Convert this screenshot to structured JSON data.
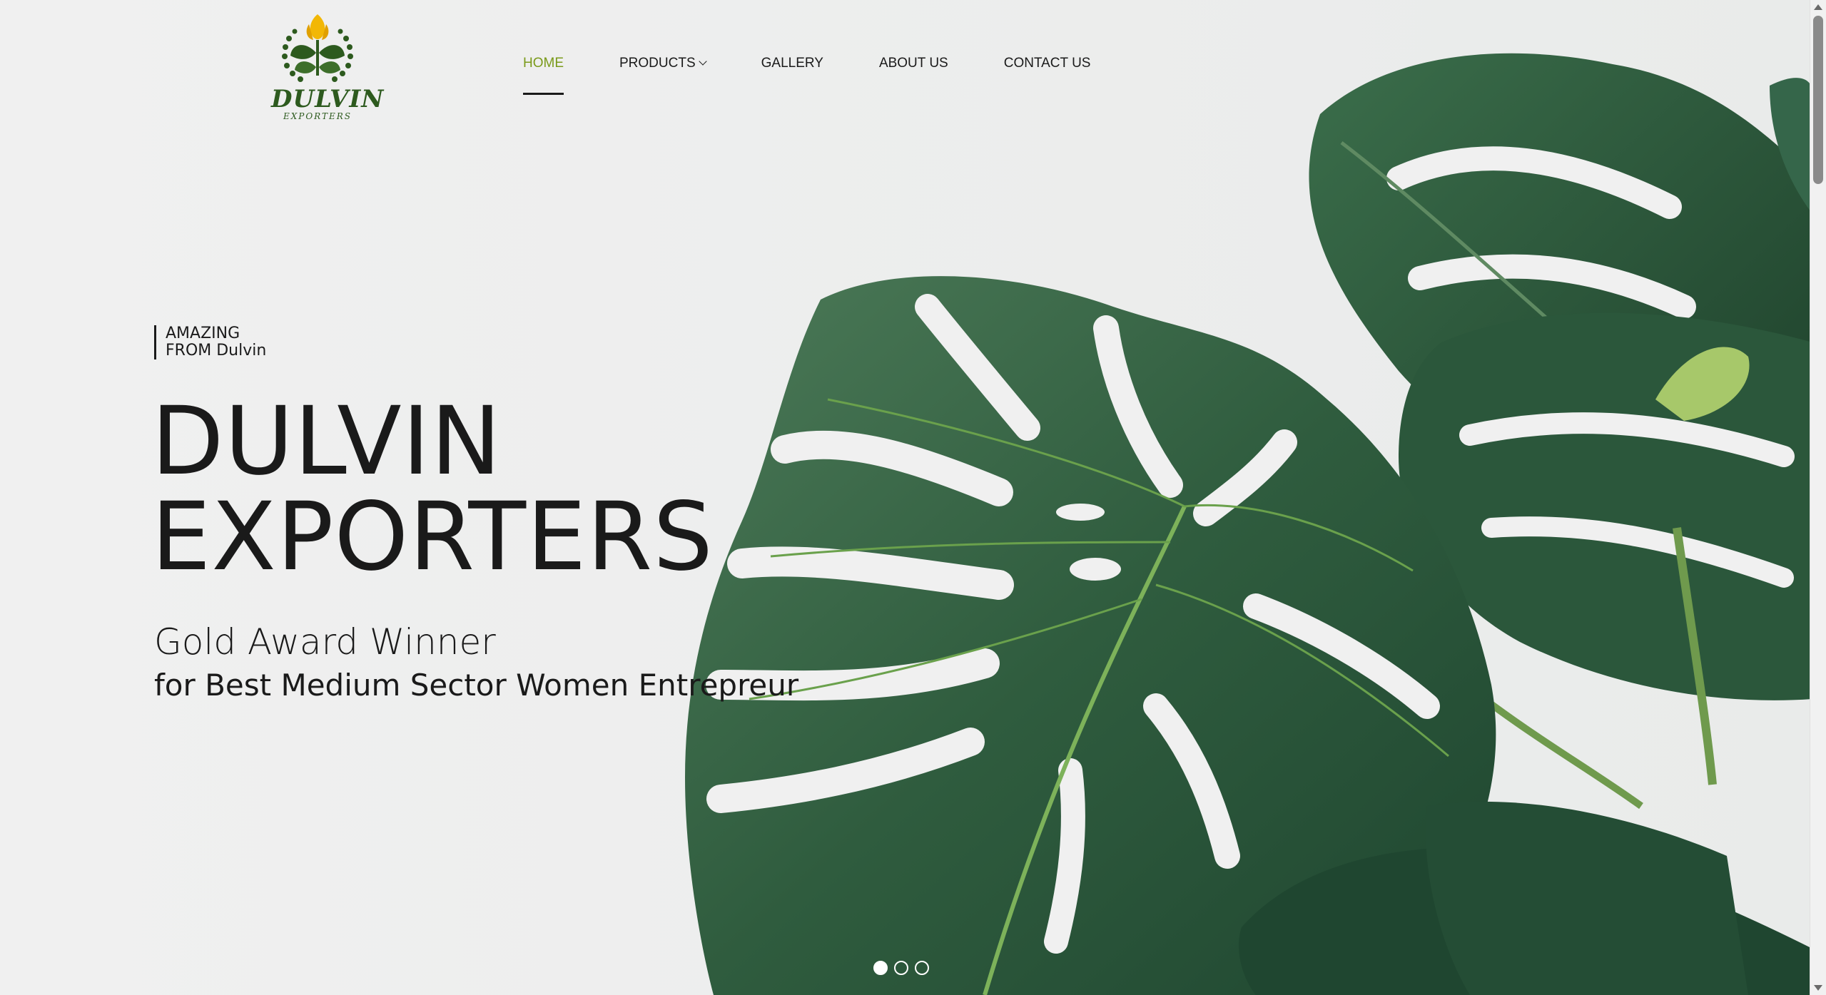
{
  "brand": {
    "name": "DULVIN",
    "sub": "EXPORTERS",
    "accent": "#7a9a1a",
    "leaf_dark": "#2d5a1e",
    "flower": "#f2b705"
  },
  "nav": {
    "items": [
      {
        "label": "HOME",
        "active": true
      },
      {
        "label": "PRODUCTS",
        "has_dropdown": true
      },
      {
        "label": "GALLERY"
      },
      {
        "label": "ABOUT US"
      },
      {
        "label": "CONTACT US"
      }
    ]
  },
  "hero": {
    "tagline_line1": "AMAZING",
    "tagline_line2": "FROM Dulvin",
    "title_line1": "DULVIN",
    "title_line2": "EXPORTERS",
    "award_title": "Gold Award Winner",
    "award_sub": "for Best Medium Sector Women Entrepreur",
    "background_icon": "monstera-leaf-image"
  },
  "slider": {
    "total": 3,
    "current": 1
  }
}
